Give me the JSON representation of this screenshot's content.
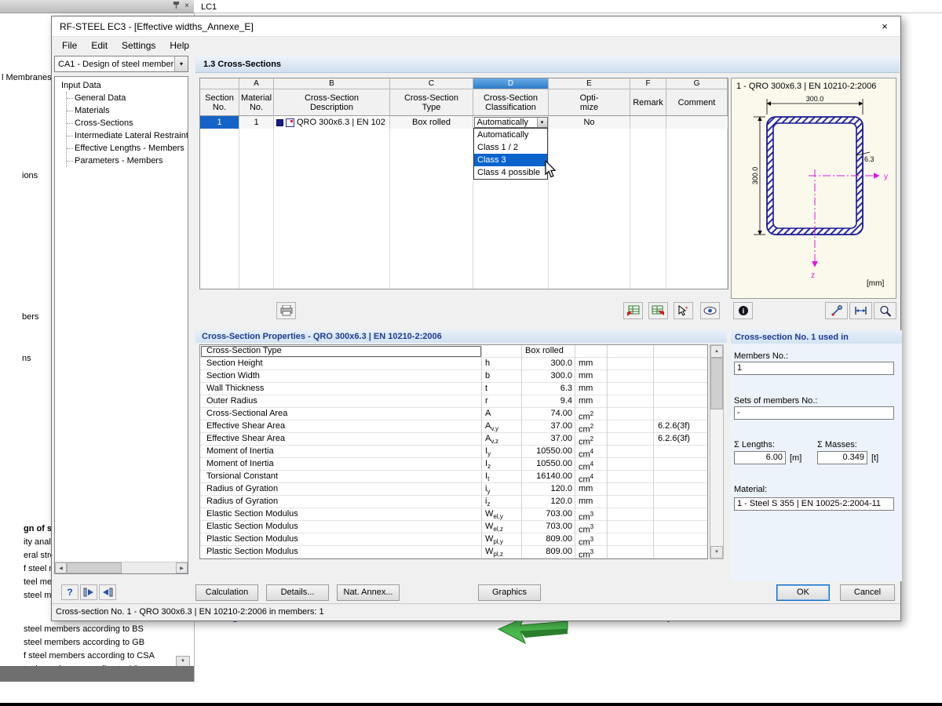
{
  "icons": {
    "close": "×",
    "dropdown_arrow": "▾",
    "up": "▲",
    "down": "▼",
    "left": "◀",
    "right": "▶",
    "help": "?",
    "info": "i"
  },
  "background": {
    "tab_label": "LC1",
    "fragments": [
      "l Membranes",
      "ions",
      "bers",
      "ns"
    ],
    "bottom_list": [
      "gn of steel m",
      "ity analysis",
      "eral stress ana",
      "f steel mem",
      "teel member",
      "steel membe",
      "steel members according to BS",
      "steel members according to GB",
      "f steel members according to CSA",
      "teel members according to AS"
    ],
    "axis_z_label": "z"
  },
  "dialog": {
    "title": "RF-STEEL EC3 - [Effective widths_Annexe_E]",
    "menu": [
      "File",
      "Edit",
      "Settings",
      "Help"
    ],
    "case_combo": "CA1 - Design of steel members",
    "nav_root": "Input Data",
    "nav_items": [
      "General Data",
      "Materials",
      "Cross-Sections",
      "Intermediate Lateral Restraints",
      "Effective Lengths - Members",
      "Parameters - Members"
    ],
    "section_title": "1.3 Cross-Sections",
    "status": "Cross-section No. 1 - QRO 300x6.3 | EN 10210-2:2006 in members: 1",
    "buttons": {
      "calculation": "Calculation",
      "details": "Details...",
      "nat_annex": "Nat. Annex...",
      "graphics": "Graphics",
      "ok": "OK",
      "cancel": "Cancel"
    }
  },
  "table": {
    "letters": [
      "A",
      "B",
      "C",
      "D",
      "E",
      "F",
      "G"
    ],
    "selected_letter": "D",
    "headers": [
      "Section\nNo.",
      "Material\nNo.",
      "Cross-Section\nDescription",
      "Cross-Section\nType",
      "Cross-Section\nClassification",
      "Opti-\nmize",
      "Remark",
      "Comment"
    ],
    "row": {
      "section": "1",
      "material": "1",
      "description": "QRO 300x6.3 | EN 102",
      "type": "Box rolled",
      "classification": "Automatically",
      "optimize": "No",
      "remark": "",
      "comment": ""
    },
    "dropdown_options": [
      "Automatically",
      "Class 1 / 2",
      "Class 3",
      "Class 4 possible"
    ],
    "dropdown_selected": "Class 3"
  },
  "properties": {
    "header": "Cross-Section Properties  -  QRO 300x6.3 | EN 10210-2:2006",
    "rows": [
      {
        "name": "Cross-Section Type",
        "sym": "",
        "sub": "",
        "value": "Box rolled",
        "unit": "",
        "usup": "",
        "note": "",
        "text": true
      },
      {
        "name": "Section Height",
        "sym": "h",
        "sub": "",
        "value": "300.0",
        "unit": "mm",
        "usup": "",
        "note": ""
      },
      {
        "name": "Section Width",
        "sym": "b",
        "sub": "",
        "value": "300.0",
        "unit": "mm",
        "usup": "",
        "note": ""
      },
      {
        "name": "Wall Thickness",
        "sym": "t",
        "sub": "",
        "value": "6.3",
        "unit": "mm",
        "usup": "",
        "note": ""
      },
      {
        "name": "Outer Radius",
        "sym": "r",
        "sub": "",
        "value": "9.4",
        "unit": "mm",
        "usup": "",
        "note": ""
      },
      {
        "name": "Cross-Sectional Area",
        "sym": "A",
        "sub": "",
        "value": "74.00",
        "unit": "cm",
        "usup": "2",
        "note": ""
      },
      {
        "name": "Effective Shear Area",
        "sym": "A",
        "sub": "v,y",
        "value": "37.00",
        "unit": "cm",
        "usup": "2",
        "note": "6.2.6(3f)"
      },
      {
        "name": "Effective Shear Area",
        "sym": "A",
        "sub": "v,z",
        "value": "37.00",
        "unit": "cm",
        "usup": "2",
        "note": "6.2.6(3f)"
      },
      {
        "name": "Moment of Inertia",
        "sym": "I",
        "sub": "y",
        "value": "10550.00",
        "unit": "cm",
        "usup": "4",
        "note": ""
      },
      {
        "name": "Moment of Inertia",
        "sym": "I",
        "sub": "z",
        "value": "10550.00",
        "unit": "cm",
        "usup": "4",
        "note": ""
      },
      {
        "name": "Torsional Constant",
        "sym": "I",
        "sub": "t",
        "value": "16140.00",
        "unit": "cm",
        "usup": "4",
        "note": ""
      },
      {
        "name": "Radius of Gyration",
        "sym": "i",
        "sub": "y",
        "value": "120.0",
        "unit": "mm",
        "usup": "",
        "note": ""
      },
      {
        "name": "Radius of Gyration",
        "sym": "i",
        "sub": "z",
        "value": "120.0",
        "unit": "mm",
        "usup": "",
        "note": ""
      },
      {
        "name": "Elastic Section Modulus",
        "sym": "W",
        "sub": "el,y",
        "value": "703.00",
        "unit": "cm",
        "usup": "3",
        "note": ""
      },
      {
        "name": "Elastic Section Modulus",
        "sym": "W",
        "sub": "el,z",
        "value": "703.00",
        "unit": "cm",
        "usup": "3",
        "note": ""
      },
      {
        "name": "Plastic Section Modulus",
        "sym": "W",
        "sub": "pl,y",
        "value": "809.00",
        "unit": "cm",
        "usup": "3",
        "note": ""
      },
      {
        "name": "Plastic Section Modulus",
        "sym": "W",
        "sub": "pl,z",
        "value": "809.00",
        "unit": "cm",
        "usup": "3",
        "note": ""
      }
    ]
  },
  "preview": {
    "title": "1 - QRO 300x6.3 | EN 10210-2:2006",
    "dim_width": "300.0",
    "dim_height": "300.0",
    "dim_thickness": "6.3",
    "axis_y": "y",
    "axis_z": "z",
    "units": "[mm]"
  },
  "usage": {
    "header": "Cross-section No. 1 used in",
    "members_label": "Members No.:",
    "members_value": "1",
    "sets_label": "Sets of members No.:",
    "sets_value": "-",
    "lengths_label": "Σ Lengths:",
    "lengths_value": "6.00",
    "lengths_unit": "[m]",
    "masses_label": "Σ Masses:",
    "masses_value": "0.349",
    "masses_unit": "[t]",
    "material_label": "Material:",
    "material_value": "1 - Steel S 355 | EN 10025-2:2004-11"
  }
}
